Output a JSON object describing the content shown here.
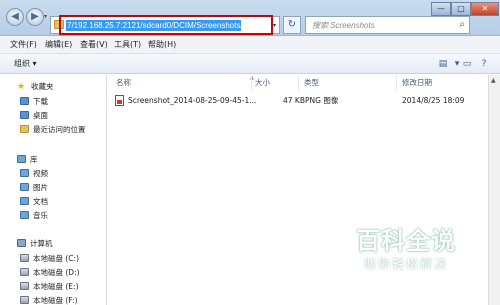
{
  "address_bar": {
    "path": "7/192.168.25.7:2121/sdcard0/DCIM/Screenshots/"
  },
  "search": {
    "placeholder": "搜索 Screenshots"
  },
  "window_controls": {
    "minimize": "—",
    "maximize": "□",
    "close": "✕"
  },
  "menu": [
    "文件(F)",
    "编辑(E)",
    "查看(V)",
    "工具(T)",
    "帮助(H)"
  ],
  "toolbar": {
    "organize": "组织 ▾"
  },
  "nav": {
    "favorites": {
      "label": "收藏夹",
      "items": [
        "下载",
        "桌面",
        "最近访问的位置"
      ]
    },
    "libraries": {
      "label": "库",
      "items": [
        "视频",
        "图片",
        "文档",
        "音乐"
      ]
    },
    "computer": {
      "label": "计算机",
      "items": [
        "本地磁盘 (C:)",
        "本地磁盘 (D:)",
        "本地磁盘 (E:)",
        "本地磁盘 (F:)"
      ]
    }
  },
  "columns": {
    "name": "名称",
    "size": "大小",
    "type": "类型",
    "modified": "修改日期"
  },
  "files": [
    {
      "name": "Screenshot_2014-08-25-09-45-1...",
      "size": "47 KB",
      "type": "PNG 图像",
      "modified": "2014/8/25 18:09"
    }
  ],
  "watermark": {
    "title": "百科全说",
    "subtitle": "助你轻松解决"
  }
}
